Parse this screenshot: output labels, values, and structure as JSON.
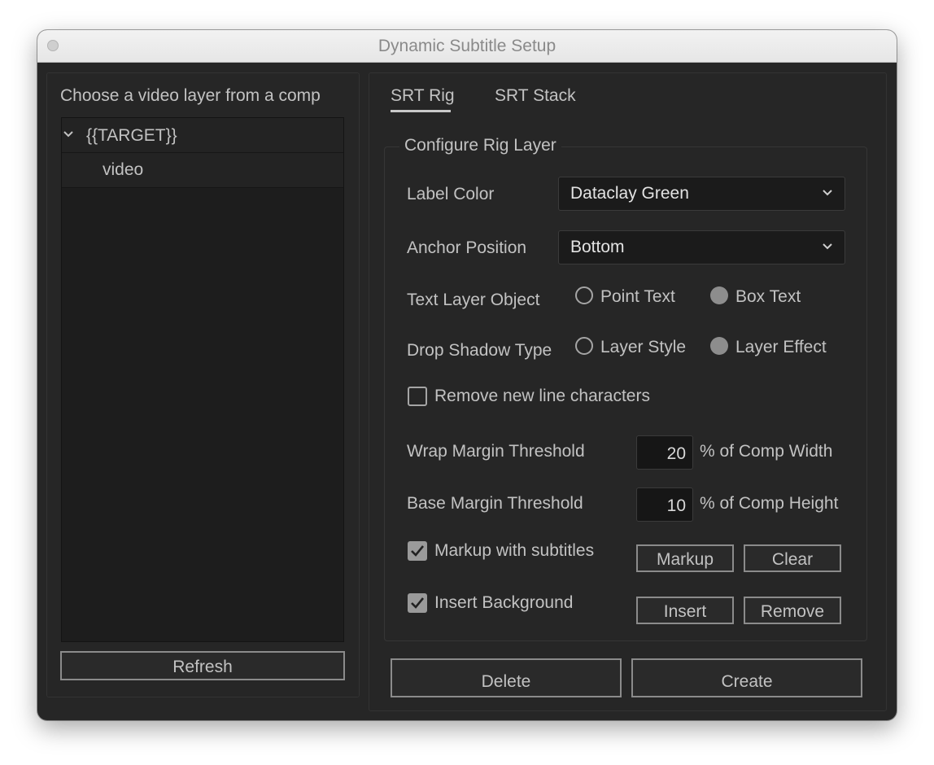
{
  "window": {
    "title": "Dynamic Subtitle Setup"
  },
  "left_panel": {
    "heading": "Choose a video layer from a comp",
    "tree": [
      {
        "label": "{{TARGET}}",
        "expanded": true,
        "icon": "chevron-down-icon"
      },
      {
        "label": "video"
      }
    ],
    "refresh_label": "Refresh"
  },
  "tabs": [
    {
      "label": "SRT Rig",
      "active": true
    },
    {
      "label": "SRT Stack",
      "active": false
    }
  ],
  "rig": {
    "group_title": "Configure Rig Layer",
    "label_color": {
      "label": "Label Color",
      "value": "Dataclay Green"
    },
    "anchor_position": {
      "label": "Anchor Position",
      "value": "Bottom"
    },
    "text_layer_object": {
      "label": "Text Layer Object",
      "options": [
        "Point Text",
        "Box Text"
      ],
      "selected": "Box Text"
    },
    "drop_shadow_type": {
      "label": "Drop Shadow Type",
      "options": [
        "Layer Style",
        "Layer Effect"
      ],
      "selected": "Layer Effect"
    },
    "remove_newlines": {
      "label": "Remove new line characters",
      "checked": false
    },
    "wrap_margin": {
      "label": "Wrap Margin Threshold",
      "value": "20",
      "unit": "% of Comp Width"
    },
    "base_margin": {
      "label": "Base Margin Threshold",
      "value": "10",
      "unit": "% of Comp Height"
    },
    "markup": {
      "label": "Markup with subtitles",
      "checked": true,
      "button_1": "Markup",
      "button_2": "Clear"
    },
    "background": {
      "label": "Insert Background",
      "checked": true,
      "button_1": "Insert",
      "button_2": "Remove"
    }
  },
  "footer": {
    "delete_label": "Delete",
    "create_label": "Create"
  },
  "colors": {
    "window_bg": "#262626",
    "list_bg": "#1d1d1d",
    "text": "#c2c2c2",
    "titlebar": "#ececec"
  }
}
